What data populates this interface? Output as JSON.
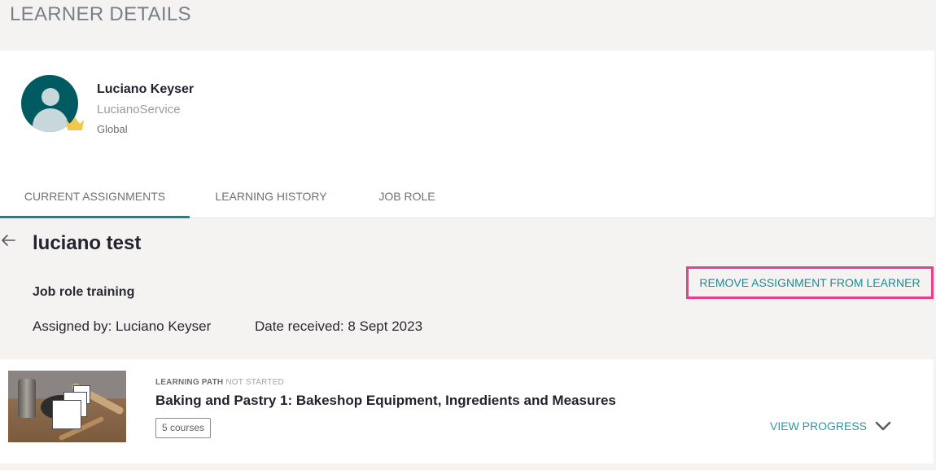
{
  "page": {
    "title": "LEARNER DETAILS"
  },
  "learner": {
    "name": "Luciano Keyser",
    "username": "LucianoService",
    "scope": "Global",
    "avatar_icon": "user-avatar-icon",
    "badge_icon": "crown-icon",
    "avatar_color": "#005a61",
    "badge_color": "#f2c84b"
  },
  "tabs": [
    {
      "label": "CURRENT ASSIGNMENTS",
      "active": true
    },
    {
      "label": "LEARNING HISTORY",
      "active": false
    },
    {
      "label": "JOB ROLE",
      "active": false
    }
  ],
  "assignment": {
    "back_icon": "arrow-left-icon",
    "title": "luciano test",
    "type": "Job role training",
    "assigned_by": "Assigned by: Luciano Keyser",
    "date_received": "Date received: 8 Sept 2023",
    "remove_label": "REMOVE ASSIGNMENT FROM LEARNER"
  },
  "course": {
    "type_label": "LEARNING PATH",
    "status_label": "NOT STARTED",
    "title": "Baking and Pastry 1: Bakeshop Equipment, Ingredients and Measures",
    "course_count": "5 courses",
    "view_progress_label": "VIEW PROGRESS",
    "expand_icon": "chevron-down-icon"
  },
  "colors": {
    "accent": "#16858f",
    "link": "#2a98a5",
    "highlight_border": "#e83e8c",
    "page_background": "#f4f3f2"
  }
}
